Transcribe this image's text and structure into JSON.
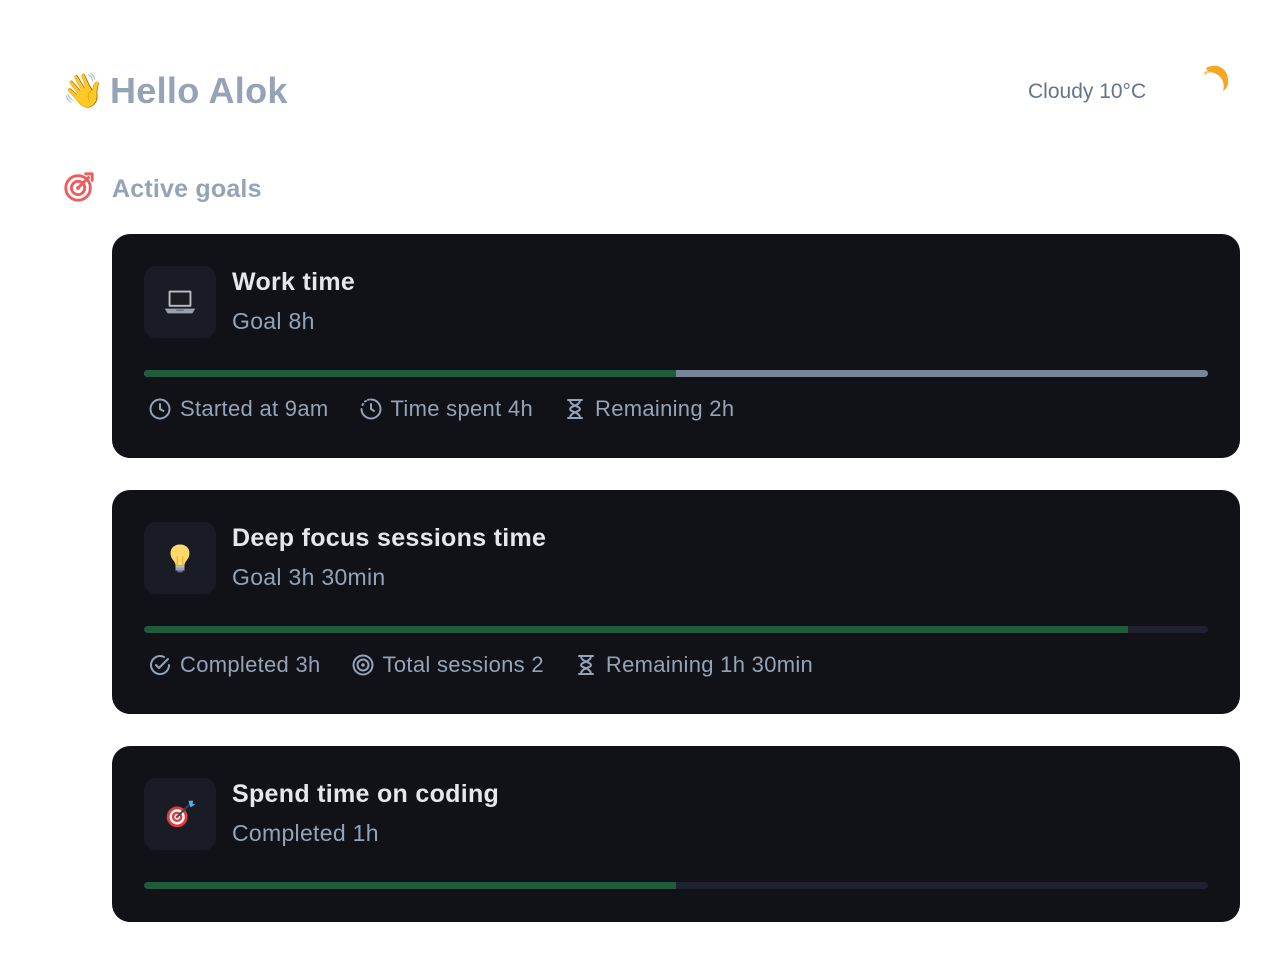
{
  "header": {
    "greeting_emoji": "👋",
    "greeting": "Hello Alok",
    "weather": "Cloudy 10°C",
    "weather_icon": "moon-icon"
  },
  "section": {
    "icon": "target-icon",
    "label": "Active goals"
  },
  "goals": [
    {
      "emoji": "💻",
      "title": "Work time",
      "subtitle": "Goal 8h",
      "progress": 0.5,
      "track_color": "#7a8499",
      "meta": [
        {
          "icon": "clock-icon",
          "text": "Started at 9am"
        },
        {
          "icon": "timer-icon",
          "text": "Time spent 4h"
        },
        {
          "icon": "hourglass-icon",
          "text": "Remaining 2h"
        }
      ]
    },
    {
      "emoji": "💡",
      "title": "Deep focus sessions time",
      "subtitle": "Goal 3h 30min",
      "progress": 0.925,
      "track_color": "#1d2130",
      "meta": [
        {
          "icon": "check-circle-icon",
          "text": "Completed 3h"
        },
        {
          "icon": "target-icon",
          "text": "Total sessions 2"
        },
        {
          "icon": "hourglass-icon",
          "text": "Remaining 1h 30min"
        }
      ]
    },
    {
      "emoji": "🎯",
      "title": "Spend time on coding",
      "subtitle": "Completed 1h",
      "progress": 0.5,
      "track_color": "#1d2130",
      "meta": []
    }
  ],
  "colors": {
    "progress_fill": "#1f5d3a",
    "card_bg": "#101217",
    "accent_red": "#ef5b5b",
    "moon_orange": "#f5a623"
  }
}
